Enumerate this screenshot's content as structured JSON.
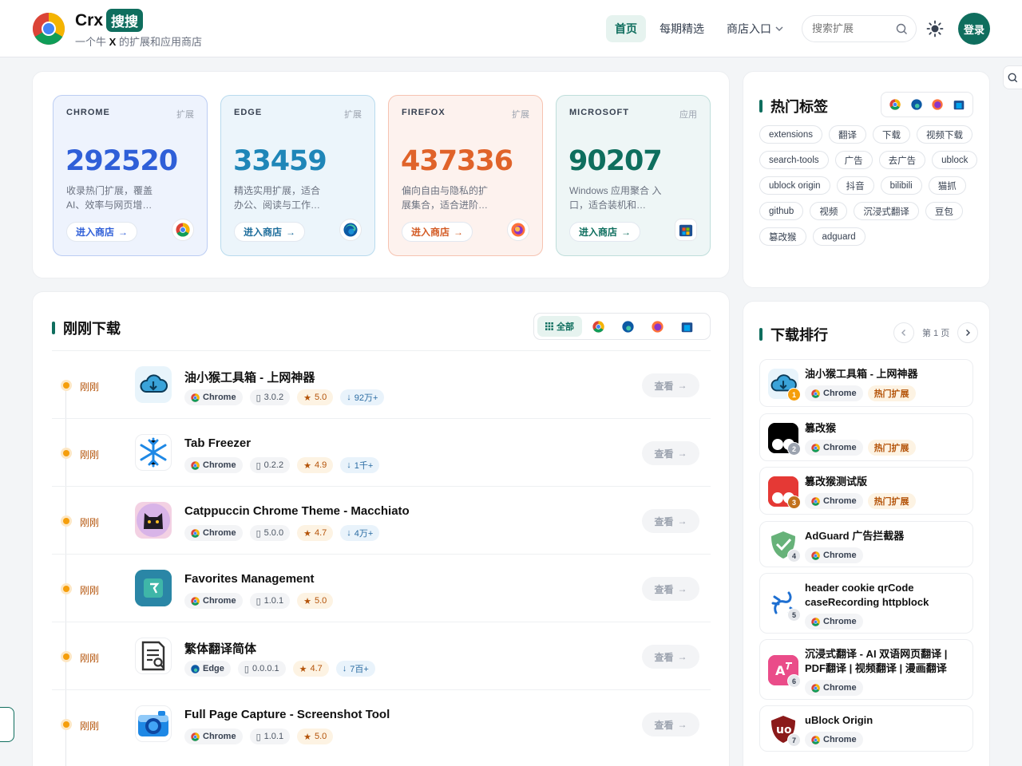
{
  "header": {
    "brand": "Crx",
    "badge": "搜搜",
    "slogan_pre": "一个牛",
    "slogan_x": "X",
    "slogan_post": "的扩展和应用商店",
    "nav": [
      {
        "label": "首页",
        "active": true
      },
      {
        "label": "每期精选"
      },
      {
        "label": "商店入口"
      }
    ],
    "search_placeholder": "搜索扩展",
    "login_label": "登录"
  },
  "stores": [
    {
      "name": "CHROME",
      "type": "扩展",
      "count": "292520",
      "desc": "收录热门扩展，覆盖 AI、效率与网页增…",
      "button": "进入商店",
      "icon": "chrome-icon"
    },
    {
      "name": "EDGE",
      "type": "扩展",
      "count": "33459",
      "desc": "精选实用扩展，适合 办公、阅读与工作…",
      "button": "进入商店",
      "icon": "edge-icon"
    },
    {
      "name": "FIREFOX",
      "type": "扩展",
      "count": "437336",
      "desc": "偏向自由与隐私的扩 展集合，适合进阶…",
      "button": "进入商店",
      "icon": "firefox-icon"
    },
    {
      "name": "MICROSOFT",
      "type": "应用",
      "count": "90207",
      "desc": "Windows 应用聚合 入口，适合装机和…",
      "button": "进入商店",
      "icon": "microsoft-store-icon"
    }
  ],
  "downloads": {
    "title": "刚刚下载",
    "filter_all": "全部",
    "view_label": "查看",
    "items": [
      {
        "time": "刚刚",
        "name": "油小猴工具箱 - 上网神器",
        "browser": "Chrome",
        "version": "3.0.2",
        "rating": "5.0",
        "downloads": "92万+"
      },
      {
        "time": "刚刚",
        "name": "Tab Freezer",
        "browser": "Chrome",
        "version": "0.2.2",
        "rating": "4.9",
        "downloads": "1千+"
      },
      {
        "time": "刚刚",
        "name": "Catppuccin Chrome Theme - Macchiato",
        "browser": "Chrome",
        "version": "5.0.0",
        "rating": "4.7",
        "downloads": "4万+"
      },
      {
        "time": "刚刚",
        "name": "Favorites Management",
        "browser": "Chrome",
        "version": "1.0.1",
        "rating": "5.0",
        "downloads": ""
      },
      {
        "time": "刚刚",
        "name": "繁体翻译简体",
        "browser": "Edge",
        "version": "0.0.0.1",
        "rating": "4.7",
        "downloads": "7百+"
      },
      {
        "time": "刚刚",
        "name": "Full Page Capture - Screenshot Tool",
        "browser": "Chrome",
        "version": "1.0.1",
        "rating": "5.0",
        "downloads": ""
      }
    ]
  },
  "tags": {
    "title": "热门标签",
    "items": [
      "extensions",
      "翻译",
      "下载",
      "视频下载",
      "search-tools",
      "广告",
      "去广告",
      "ublock",
      "ublock origin",
      "抖音",
      "bilibili",
      "猫抓",
      "github",
      "视频",
      "沉浸式翻译",
      "豆包",
      "篡改猴",
      "adguard"
    ]
  },
  "ranking": {
    "title": "下载排行",
    "page": "第 1 页",
    "hot_label": "热门扩展",
    "items": [
      {
        "rank": "1",
        "name": "油小猴工具箱 - 上网神器",
        "browser": "Chrome",
        "hot": true
      },
      {
        "rank": "2",
        "name": "篡改猴",
        "browser": "Chrome",
        "hot": true
      },
      {
        "rank": "3",
        "name": "篡改猴测试版",
        "browser": "Chrome",
        "hot": true
      },
      {
        "rank": "4",
        "name": "AdGuard 广告拦截器",
        "browser": "Chrome",
        "hot": false
      },
      {
        "rank": "5",
        "name": "header cookie qrCode caseRecording httpblock",
        "browser": "Chrome",
        "hot": false
      },
      {
        "rank": "6",
        "name": "沉浸式翻译 - AI 双语网页翻译 | PDF翻译 | 视频翻译 | 漫画翻译",
        "browser": "Chrome",
        "hot": false
      },
      {
        "rank": "7",
        "name": "uBlock Origin",
        "browser": "Chrome",
        "hot": false
      }
    ]
  },
  "colors": {
    "accent": "#0f6e5e",
    "chrome": "#2f5fd8",
    "edge": "#1f86b8",
    "firefox": "#e0632a",
    "microsoft": "#0e6e5e"
  }
}
